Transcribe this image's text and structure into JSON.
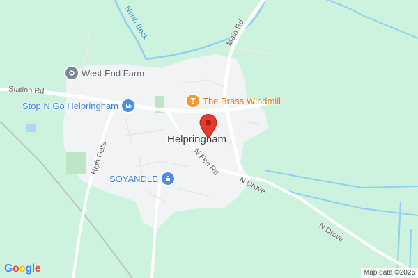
{
  "map": {
    "town_label": "Helpringham",
    "roads": {
      "station_rd": "Station Rd",
      "main_rd": "Main Rd",
      "high_gate": "High Gate",
      "n_fen_rd": "N Fen Rd",
      "n_drove_1": "N Drove",
      "n_drove_2": "N Drove"
    },
    "waterways": {
      "north_beck": "North Beck"
    },
    "pois": [
      {
        "label": "West End Farm",
        "icon": "location-dot-icon",
        "color": "#7a8791"
      },
      {
        "label": "Stop N Go Helpringham",
        "icon": "fuel-pump-icon",
        "color": "#4a8ee6"
      },
      {
        "label": "The Brass Windmill",
        "icon": "cocktail-glass-icon",
        "color": "#f29a2e"
      },
      {
        "label": "SOYANDLE",
        "icon": "shopping-bag-icon",
        "color": "#4a8ee6"
      }
    ],
    "marker": {
      "icon": "red-map-pin-icon",
      "color": "#e5392c"
    }
  },
  "footer": {
    "logo": "Google",
    "attribution": "Map data ©2025"
  }
}
